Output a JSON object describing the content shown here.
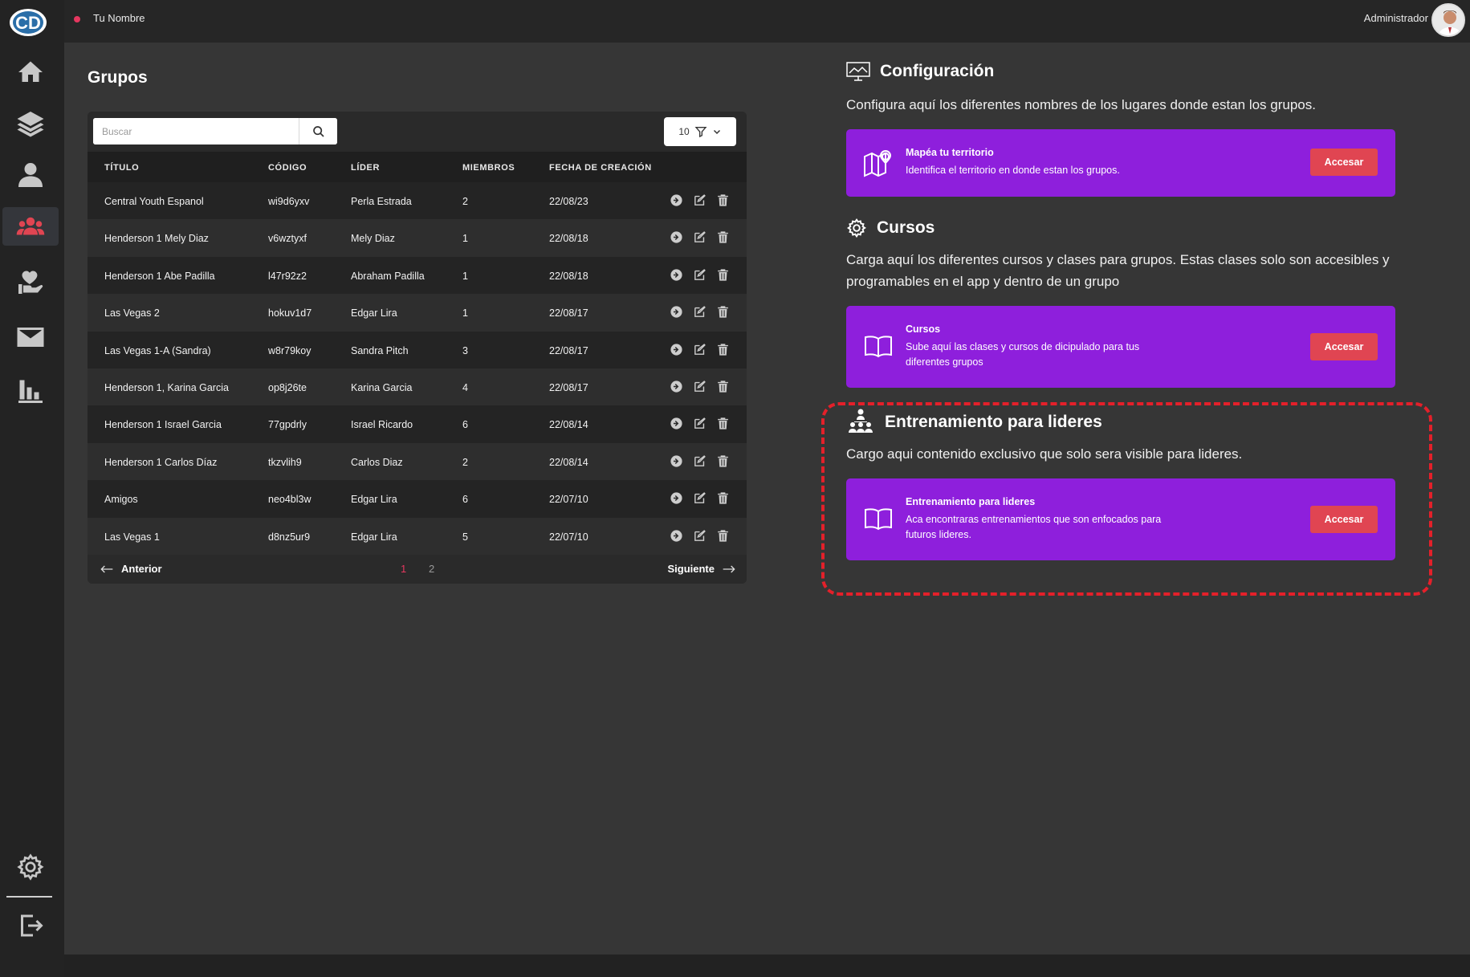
{
  "app": {
    "logo": "CD"
  },
  "topbar": {
    "user_name": "Tu Nombre",
    "role": "Administrador"
  },
  "sidebar": {
    "items": [
      {
        "name": "home-icon",
        "active": false
      },
      {
        "name": "layers-icon",
        "active": false
      },
      {
        "name": "user-icon",
        "active": false
      },
      {
        "name": "groups-icon",
        "active": true
      },
      {
        "name": "care-icon",
        "active": false
      },
      {
        "name": "mail-icon",
        "active": false
      },
      {
        "name": "stats-icon",
        "active": false
      }
    ],
    "bottom": [
      {
        "name": "gear-icon"
      },
      {
        "name": "logout-icon"
      }
    ]
  },
  "groups": {
    "title": "Grupos",
    "search_placeholder": "Buscar",
    "page_size": "10",
    "columns": [
      "TÍTULO",
      "CÓDIGO",
      "LÍDER",
      "MIEMBROS",
      "FECHA DE CREACIÓN"
    ],
    "rows": [
      {
        "titulo": "Central Youth Espanol",
        "codigo": "wi9d6yxv",
        "lider": "Perla Estrada",
        "miembros": "2",
        "fecha": "22/08/23"
      },
      {
        "titulo": "Henderson 1 Mely Diaz",
        "codigo": "v6wztyxf",
        "lider": "Mely Diaz",
        "miembros": "1",
        "fecha": "22/08/18"
      },
      {
        "titulo": "Henderson 1 Abe Padilla",
        "codigo": "l47r92z2",
        "lider": "Abraham Padilla",
        "miembros": "1",
        "fecha": "22/08/18"
      },
      {
        "titulo": "Las Vegas 2",
        "codigo": "hokuv1d7",
        "lider": "Edgar Lira",
        "miembros": "1",
        "fecha": "22/08/17"
      },
      {
        "titulo": "Las Vegas 1-A (Sandra)",
        "codigo": "w8r79koy",
        "lider": "Sandra Pitch",
        "miembros": "3",
        "fecha": "22/08/17"
      },
      {
        "titulo": "Henderson 1, Karina Garcia",
        "codigo": "op8j26te",
        "lider": "Karina Garcia",
        "miembros": "4",
        "fecha": "22/08/17"
      },
      {
        "titulo": "Henderson 1 Israel Garcia",
        "codigo": "77gpdrly",
        "lider": "Israel Ricardo",
        "miembros": "6",
        "fecha": "22/08/14"
      },
      {
        "titulo": "Henderson 1 Carlos Díaz",
        "codigo": "tkzvlih9",
        "lider": "Carlos Diaz",
        "miembros": "2",
        "fecha": "22/08/14"
      },
      {
        "titulo": "Amigos",
        "codigo": "neo4bl3w",
        "lider": "Edgar Lira",
        "miembros": "6",
        "fecha": "22/07/10"
      },
      {
        "titulo": "Las Vegas 1",
        "codigo": "d8nz5ur9",
        "lider": "Edgar Lira",
        "miembros": "5",
        "fecha": "22/07/10"
      }
    ],
    "pager": {
      "prev": "Anterior",
      "next": "Siguiente",
      "pages": [
        "1",
        "2"
      ],
      "current": "1"
    }
  },
  "config": {
    "title": "Configuración",
    "desc": "Configura aquí los diferentes nombres de los lugares donde estan los grupos.",
    "card": {
      "title": "Mapéa tu territorio",
      "desc": "Identifica el territorio en donde estan los grupos.",
      "button": "Accesar"
    }
  },
  "cursos": {
    "title": "Cursos",
    "desc": "Carga aquí los diferentes cursos y clases para grupos. Estas clases solo son accesibles y programables en el app y dentro de un grupo",
    "card": {
      "title": "Cursos",
      "desc": "Sube aquí las clases y cursos de dicipulado para tus diferentes grupos",
      "button": "Accesar"
    }
  },
  "training": {
    "title": "Entrenamiento para lideres",
    "desc": "Cargo aqui contenido exclusivo que solo sera visible para lideres.",
    "card": {
      "title": "Entrenamiento para lideres",
      "desc": "Aca encontraras entrenamientos que son enfocados para futuros lideres.",
      "button": "Accesar"
    }
  },
  "colors": {
    "accent": "#e04552",
    "purple": "#8e1fdc",
    "highlight": "#e4202a"
  }
}
